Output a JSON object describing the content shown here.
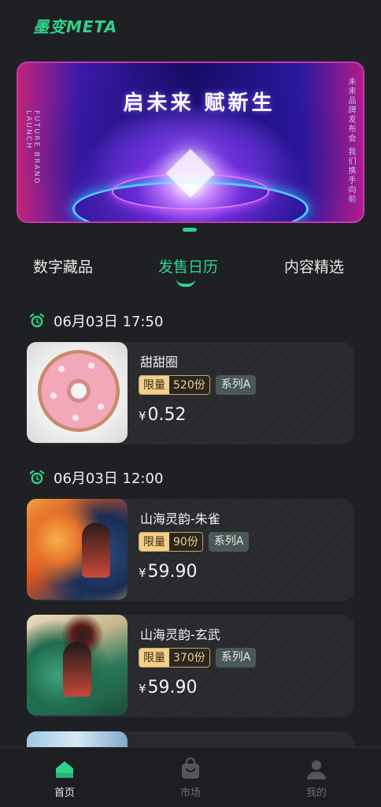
{
  "app": {
    "logo": "墨变META"
  },
  "banner": {
    "headline": "启未来 赋新生",
    "side_text_right": "未来品牌发布会 我们携手向前",
    "side_text_left": "FUTURE BRAND LAUNCH"
  },
  "tabs": [
    {
      "label": "数字藏品",
      "active": false
    },
    {
      "label": "发售日历",
      "active": true
    },
    {
      "label": "内容精选",
      "active": false
    }
  ],
  "groups": [
    {
      "time": "06月03日 17:50",
      "items": [
        {
          "title": "甜甜圈",
          "limit_label": "限量",
          "quantity": "520份",
          "series": "系列A",
          "currency": "¥",
          "price": "0.52"
        }
      ]
    },
    {
      "time": "06月03日 12:00",
      "items": [
        {
          "title": "山海灵韵-朱雀",
          "limit_label": "限量",
          "quantity": "90份",
          "series": "系列A",
          "currency": "¥",
          "price": "59.90"
        },
        {
          "title": "山海灵韵-玄武",
          "limit_label": "限量",
          "quantity": "370份",
          "series": "系列A",
          "currency": "¥",
          "price": "59.90"
        }
      ]
    }
  ],
  "bottom_nav": [
    {
      "label": "首页",
      "icon": "home-icon",
      "active": true
    },
    {
      "label": "市场",
      "icon": "market-bag-icon",
      "active": false
    },
    {
      "label": "我的",
      "icon": "user-icon",
      "active": false
    }
  ],
  "colors": {
    "accent": "#2fd38d",
    "background": "#1f2023",
    "card": "#292a2e",
    "limit_gold": "#f2cf8a",
    "series_badge": "#4a5856"
  }
}
